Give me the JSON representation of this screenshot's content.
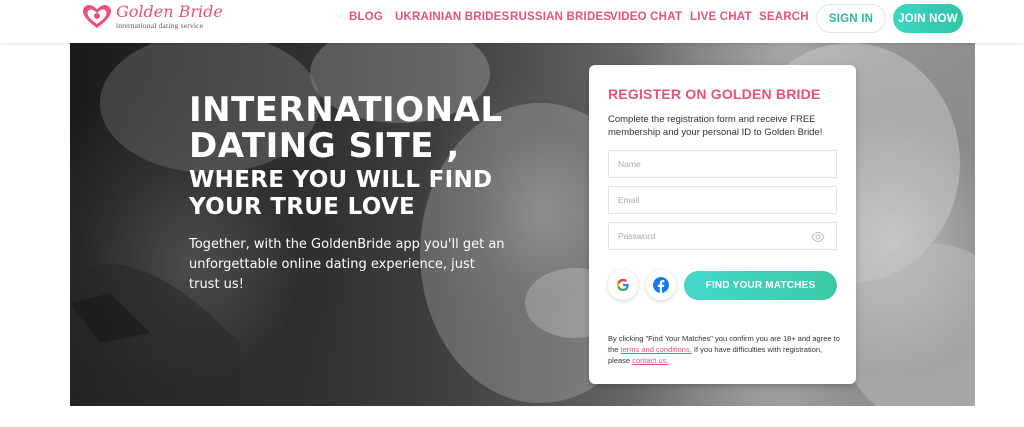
{
  "header": {
    "logo": {
      "title": "Golden Bride",
      "subtitle": "international dating service"
    },
    "nav": {
      "blog": "BLOG",
      "ukrainian": "UKRAINIAN BRIDES",
      "russian": "RUSSIAN BRIDES",
      "video_chat": "VIDEO CHAT",
      "live_chat": "LIVE CHAT",
      "search": "SEARCH"
    },
    "sign_in": "SIGN IN",
    "join_now": "JOIN NOW"
  },
  "hero": {
    "headline": "INTERNATIONAL DATING SITE ,",
    "subheadline": "WHERE YOU WILL FIND YOUR TRUE LOVE",
    "description": "Together, with the GoldenBride app you'll get an unforgettable online dating experience, just trust us!"
  },
  "registration": {
    "title": "REGISTER ON GOLDEN BRIDE",
    "description": "Complete the registration form and receive FREE membership and your personal ID to Golden Bride!",
    "fields": {
      "name_placeholder": "Name",
      "email_placeholder": "Email",
      "password_placeholder": "Password"
    },
    "find_button": "FIND YOUR MATCHES",
    "legal": {
      "part1": "By clicking \"Find Your Matches\" you confirm you are 18+ and agree to the ",
      "terms_link": "terms and conditions.",
      "part2": " If you have difficulties with registration, please ",
      "contact_link": "contact us."
    }
  },
  "colors": {
    "brand_pink": "#e8517a",
    "brand_teal": "#2ec4a8"
  },
  "icons": [
    "heart-logo-icon",
    "eye-icon",
    "google-icon",
    "facebook-icon"
  ]
}
